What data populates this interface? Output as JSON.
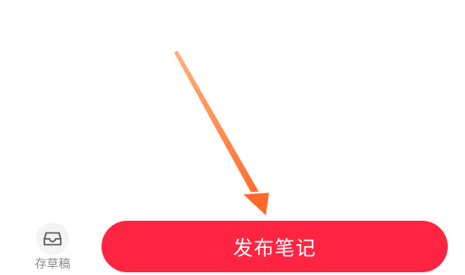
{
  "bottom_bar": {
    "draft_label": "存草稿",
    "publish_label": "发布笔记"
  },
  "colors": {
    "publish_bg": "#ff2442",
    "arrow": "#ff7a3d",
    "draft_icon_bg": "#f4f4f4"
  },
  "icons": {
    "draft": "inbox-tray-icon",
    "annotation": "arrow-annotation"
  }
}
